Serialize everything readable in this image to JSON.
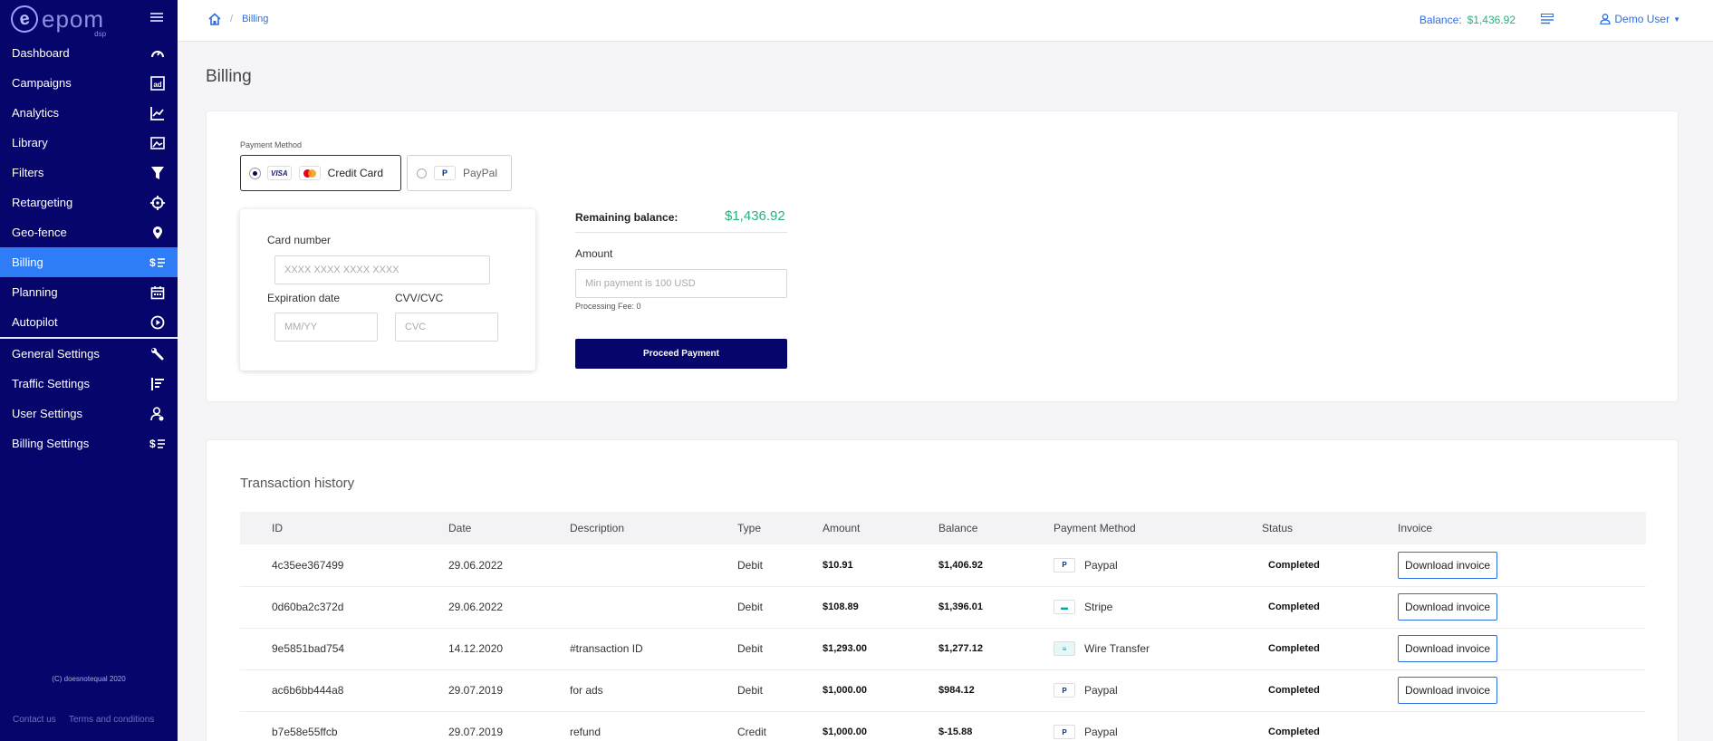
{
  "sidebar": {
    "logo_text": "epom",
    "logo_sub": "dsp",
    "items": [
      {
        "label": "Dashboard",
        "icon": "gauge-icon"
      },
      {
        "label": "Campaigns",
        "icon": "ad-icon"
      },
      {
        "label": "Analytics",
        "icon": "chart-line-icon"
      },
      {
        "label": "Library",
        "icon": "image-icon"
      },
      {
        "label": "Filters",
        "icon": "funnel-icon"
      },
      {
        "label": "Retargeting",
        "icon": "crosshair-icon"
      },
      {
        "label": "Geo-fence",
        "icon": "map-pin-icon"
      },
      {
        "label": "Billing",
        "icon": "dollar-list-icon"
      },
      {
        "label": "Planning",
        "icon": "calendar-icon"
      },
      {
        "label": "Autopilot",
        "icon": "play-circle-icon"
      }
    ],
    "settings_items": [
      {
        "label": "General Settings",
        "icon": "wrench-icon"
      },
      {
        "label": "Traffic Settings",
        "icon": "traffic-list-icon"
      },
      {
        "label": "User Settings",
        "icon": "user-gear-icon"
      },
      {
        "label": "Billing Settings",
        "icon": "dollar-list-icon"
      }
    ],
    "active": "Billing",
    "copyright": "(C) doesnotequal 2020",
    "footer_links": [
      "Contact us",
      "Terms and conditions"
    ]
  },
  "topbar": {
    "breadcrumb": "Billing",
    "balance_label": "Balance:",
    "balance_value": "$1,436.92",
    "user": "Demo User"
  },
  "page_title": "Billing",
  "payment": {
    "method_label": "Payment Method",
    "options": [
      {
        "label": "Credit Card",
        "selected": true
      },
      {
        "label": "PayPal",
        "selected": false
      }
    ],
    "card_number_label": "Card number",
    "card_number_placeholder": "XXXX XXXX XXXX XXXX",
    "expiration_label": "Expiration date",
    "expiration_placeholder": "MM/YY",
    "cvv_label": "CVV/CVC",
    "cvv_placeholder": "CVC",
    "remaining_label": "Remaining balance:",
    "remaining_value": "$1,436.92",
    "amount_label": "Amount",
    "amount_placeholder": "Min payment is 100 USD",
    "fee_text": "Processing Fee: 0",
    "proceed_label": "Proceed Payment"
  },
  "transactions": {
    "title": "Transaction history",
    "headers": [
      "ID",
      "Date",
      "Description",
      "Type",
      "Amount",
      "Balance",
      "Payment Method",
      "Status",
      "Invoice"
    ],
    "download_label": "Download invoice",
    "rows": [
      {
        "id": "4c35ee367499",
        "date": "29.06.2022",
        "description": "",
        "type": "Debit",
        "amount": "$10.91",
        "balance": "$1,406.92",
        "method": "Paypal",
        "method_icon": "paypal-icon",
        "status": "Completed",
        "invoice": true
      },
      {
        "id": "0d60ba2c372d",
        "date": "29.06.2022",
        "description": "",
        "type": "Debit",
        "amount": "$108.89",
        "balance": "$1,396.01",
        "method": "Stripe",
        "method_icon": "stripe-icon",
        "status": "Completed",
        "invoice": true
      },
      {
        "id": "9e5851bad754",
        "date": "14.12.2020",
        "description": "#transaction ID",
        "type": "Debit",
        "amount": "$1,293.00",
        "balance": "$1,277.12",
        "method": "Wire Transfer",
        "method_icon": "wire-transfer-icon",
        "status": "Completed",
        "invoice": true
      },
      {
        "id": "ac6b6bb444a8",
        "date": "29.07.2019",
        "description": "for ads",
        "type": "Debit",
        "amount": "$1,000.00",
        "balance": "$984.12",
        "method": "Paypal",
        "method_icon": "paypal-icon",
        "status": "Completed",
        "invoice": true
      },
      {
        "id": "b7e58e55ffcb",
        "date": "29.07.2019",
        "description": "refund",
        "type": "Credit",
        "amount": "$1,000.00",
        "balance": "$-15.88",
        "method": "Paypal",
        "method_icon": "paypal-icon",
        "status": "Completed",
        "invoice": false
      }
    ]
  },
  "colors": {
    "sidebar_bg": "#05056b",
    "active_item": "#2e7cf6",
    "link_blue": "#2e6de0",
    "money_green": "#26b37a"
  }
}
